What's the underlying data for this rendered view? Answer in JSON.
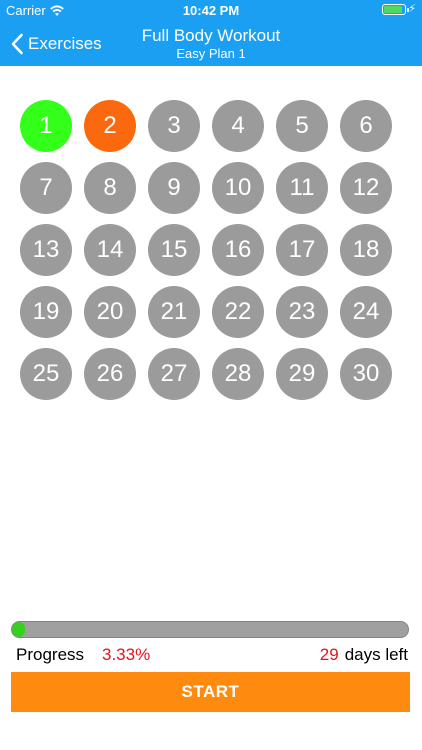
{
  "status_bar": {
    "carrier": "Carrier",
    "time": "10:42 PM",
    "wifi_icon": "wifi-icon",
    "battery_icon": "battery-icon",
    "battery_level": 0.9,
    "charging_icon": "bolt-icon",
    "bolt_glyph": "⚡"
  },
  "nav": {
    "back_label": "Exercises",
    "back_icon": "chevron-left-icon",
    "title": "Full Body Workout",
    "subtitle": "Easy Plan 1"
  },
  "colors": {
    "header_bg": "#1a9ff2",
    "day_done": "#33ff1a",
    "day_current": "#fb690f",
    "day_pending": "#9b9b9b",
    "progress_fill": "#35d11c",
    "progress_track": "#a0a0a0",
    "highlight_text": "#e8121a",
    "start_button": "#fe8a0f"
  },
  "days": [
    {
      "label": "1",
      "state": "done"
    },
    {
      "label": "2",
      "state": "current"
    },
    {
      "label": "3",
      "state": "pending"
    },
    {
      "label": "4",
      "state": "pending"
    },
    {
      "label": "5",
      "state": "pending"
    },
    {
      "label": "6",
      "state": "pending"
    },
    {
      "label": "7",
      "state": "pending"
    },
    {
      "label": "8",
      "state": "pending"
    },
    {
      "label": "9",
      "state": "pending"
    },
    {
      "label": "10",
      "state": "pending"
    },
    {
      "label": "11",
      "state": "pending"
    },
    {
      "label": "12",
      "state": "pending"
    },
    {
      "label": "13",
      "state": "pending"
    },
    {
      "label": "14",
      "state": "pending"
    },
    {
      "label": "15",
      "state": "pending"
    },
    {
      "label": "16",
      "state": "pending"
    },
    {
      "label": "17",
      "state": "pending"
    },
    {
      "label": "18",
      "state": "pending"
    },
    {
      "label": "19",
      "state": "pending"
    },
    {
      "label": "20",
      "state": "pending"
    },
    {
      "label": "21",
      "state": "pending"
    },
    {
      "label": "22",
      "state": "pending"
    },
    {
      "label": "23",
      "state": "pending"
    },
    {
      "label": "24",
      "state": "pending"
    },
    {
      "label": "25",
      "state": "pending"
    },
    {
      "label": "26",
      "state": "pending"
    },
    {
      "label": "27",
      "state": "pending"
    },
    {
      "label": "28",
      "state": "pending"
    },
    {
      "label": "29",
      "state": "pending"
    },
    {
      "label": "30",
      "state": "pending"
    }
  ],
  "progress": {
    "label": "Progress",
    "percent_text": "3.33%",
    "fraction": 0.0333,
    "days_left_count": "29",
    "days_left_label": "days left"
  },
  "start_button": {
    "label": "START"
  }
}
